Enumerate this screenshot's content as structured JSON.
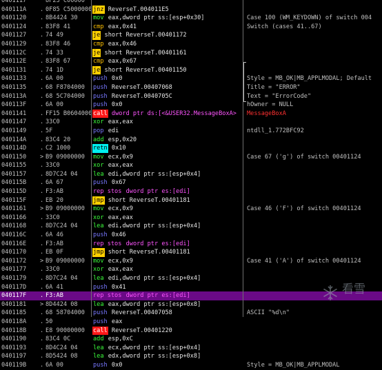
{
  "rows": [
    {
      "addr": "0401117",
      "mark": "",
      "hex": "8F23 C00000",
      "mn": "",
      "mk": "",
      "op": "",
      "oc": "",
      "cmt": "",
      "cc": ""
    },
    {
      "addr": "040111A",
      "mark": ".",
      "hex": "0F85 C5000000",
      "mn": "jnz",
      "mk": "jmp",
      "op": "ReverseT.004011E5",
      "oc": "",
      "cmt": "",
      "cc": ""
    },
    {
      "addr": "0401120",
      "mark": ".",
      "hex": "8B4424 30",
      "mn": "mov",
      "mk": "mov",
      "op": "eax,dword ptr ss:[esp+0x30]",
      "oc": "",
      "cmt": "Case 100 (WM_KEYDOWN) of switch 004",
      "cc": ""
    },
    {
      "addr": "0401124",
      "mark": ".",
      "hex": "83F8 41",
      "mn": "cmp",
      "mk": "cmp",
      "op": "eax,0x41",
      "oc": "",
      "cmt": "Switch (cases 41..67)",
      "cc": ""
    },
    {
      "addr": "0401127",
      "mark": ".",
      "hex": "74 49",
      "mn": "je",
      "mk": "jmp",
      "op": "short ReverseT.00401172",
      "oc": "",
      "cmt": "",
      "cc": ""
    },
    {
      "addr": "0401129",
      "mark": ".",
      "hex": "83F8 46",
      "mn": "cmp",
      "mk": "cmp",
      "op": "eax,0x46",
      "oc": "",
      "cmt": "",
      "cc": ""
    },
    {
      "addr": "040112C",
      "mark": ".",
      "hex": "74 33",
      "mn": "je",
      "mk": "jmp",
      "op": "short ReverseT.00401161",
      "oc": "",
      "cmt": "",
      "cc": ""
    },
    {
      "addr": "040112E",
      "mark": ".",
      "hex": "83F8 67",
      "mn": "cmp",
      "mk": "cmp",
      "op": "eax,0x67",
      "oc": "",
      "cmt": "",
      "cc": ""
    },
    {
      "addr": "0401131",
      "mark": ".",
      "hex": "74 1D",
      "mn": "je",
      "mk": "jmp",
      "op": "short ReverseT.00401150",
      "oc": "",
      "cmt": "",
      "cc": ""
    },
    {
      "addr": "0401133",
      "mark": ".",
      "hex": "6A 00",
      "mn": "push",
      "mk": "push",
      "op": "0x0",
      "oc": "",
      "cmt": "Style = MB_OK|MB_APPLMODAL; Default",
      "cc": ""
    },
    {
      "addr": "0401135",
      "mark": ".",
      "hex": "68 F8704000",
      "mn": "push",
      "mk": "push",
      "op": "ReverseT.00407068",
      "oc": "",
      "cmt": "Title = \"ERROR\"",
      "cc": ""
    },
    {
      "addr": "040113A",
      "mark": ".",
      "hex": "68 5C704000",
      "mn": "push",
      "mk": "push",
      "op": "ReverseT.0040705C",
      "oc": "",
      "cmt": "Text = \"ErrorCode\"",
      "cc": ""
    },
    {
      "addr": "040113F",
      "mark": ".",
      "hex": "6A 00",
      "mn": "push",
      "mk": "push",
      "op": "0x0",
      "oc": "",
      "cmt": "hOwner = NULL",
      "cc": ""
    },
    {
      "addr": "0401141",
      "mark": ".",
      "hex": "FF15 B0604000",
      "mn": "call",
      "mk": "call",
      "op": "dword ptr ds:[<&USER32.MessageBoxA>",
      "oc": "mag",
      "cmt": "MessageBoxA",
      "cc": "red"
    },
    {
      "addr": "0401147",
      "mark": ".",
      "hex": "33C0",
      "mn": "xor",
      "mk": "xor",
      "op": "eax,eax",
      "oc": "",
      "cmt": "",
      "cc": ""
    },
    {
      "addr": "0401149",
      "mark": ".",
      "hex": "5F",
      "mn": "pop",
      "mk": "pop",
      "op": "edi",
      "oc": "",
      "cmt": "ntdll_1.772BFC92",
      "cc": ""
    },
    {
      "addr": "040114A",
      "mark": ".",
      "hex": "83C4 20",
      "mn": "add",
      "mk": "add",
      "op": "esp,0x20",
      "oc": "",
      "cmt": "",
      "cc": ""
    },
    {
      "addr": "040114D",
      "mark": ".",
      "hex": "C2 1000",
      "mn": "retn",
      "mk": "retn",
      "op": "0x10",
      "oc": "",
      "cmt": "",
      "cc": ""
    },
    {
      "addr": "0401150",
      "mark": ">",
      "hex": "B9 09000000",
      "mn": "mov",
      "mk": "mov",
      "op": "ecx,0x9",
      "oc": "",
      "cmt": "Case 67 ('g') of switch 00401124",
      "cc": ""
    },
    {
      "addr": "0401155",
      "mark": ".",
      "hex": "33C0",
      "mn": "xor",
      "mk": "xor",
      "op": "eax,eax",
      "oc": "",
      "cmt": "",
      "cc": ""
    },
    {
      "addr": "0401157",
      "mark": ".",
      "hex": "8D7C24 04",
      "mn": "lea",
      "mk": "lea",
      "op": "edi,dword ptr ss:[esp+0x4]",
      "oc": "",
      "cmt": "",
      "cc": ""
    },
    {
      "addr": "040115B",
      "mark": ".",
      "hex": "6A 67",
      "mn": "push",
      "mk": "push",
      "op": "0x67",
      "oc": "",
      "cmt": "",
      "cc": ""
    },
    {
      "addr": "040115D",
      "mark": ".",
      "hex": "F3:AB",
      "mn": "rep stos",
      "mk": "stos",
      "op": "dword ptr es:[edi]",
      "oc": "mag",
      "cmt": "",
      "cc": ""
    },
    {
      "addr": "040115F",
      "mark": ".",
      "hex": "EB 20",
      "mn": "jmp",
      "mk": "jmp",
      "op": "short ReverseT.00401181",
      "oc": "",
      "cmt": "",
      "cc": ""
    },
    {
      "addr": "0401161",
      "mark": ">",
      "hex": "B9 09000000",
      "mn": "mov",
      "mk": "mov",
      "op": "ecx,0x9",
      "oc": "",
      "cmt": "Case 46 ('F') of switch 00401124",
      "cc": ""
    },
    {
      "addr": "0401166",
      "mark": ".",
      "hex": "33C0",
      "mn": "xor",
      "mk": "xor",
      "op": "eax,eax",
      "oc": "",
      "cmt": "",
      "cc": ""
    },
    {
      "addr": "0401168",
      "mark": ".",
      "hex": "8D7C24 04",
      "mn": "lea",
      "mk": "lea",
      "op": "edi,dword ptr ss:[esp+0x4]",
      "oc": "",
      "cmt": "",
      "cc": ""
    },
    {
      "addr": "040116C",
      "mark": ".",
      "hex": "6A 46",
      "mn": "push",
      "mk": "push",
      "op": "0x46",
      "oc": "",
      "cmt": "",
      "cc": ""
    },
    {
      "addr": "040116E",
      "mark": ".",
      "hex": "F3:AB",
      "mn": "rep stos",
      "mk": "stos",
      "op": "dword ptr es:[edi]",
      "oc": "mag",
      "cmt": "",
      "cc": ""
    },
    {
      "addr": "0401170",
      "mark": ".",
      "hex": "EB 0F",
      "mn": "jmp",
      "mk": "jmp",
      "op": "short ReverseT.00401181",
      "oc": "",
      "cmt": "",
      "cc": ""
    },
    {
      "addr": "0401172",
      "mark": ">",
      "hex": "B9 09000000",
      "mn": "mov",
      "mk": "mov",
      "op": "ecx,0x9",
      "oc": "",
      "cmt": "Case 41 ('A') of switch 00401124",
      "cc": ""
    },
    {
      "addr": "0401177",
      "mark": ".",
      "hex": "33C0",
      "mn": "xor",
      "mk": "xor",
      "op": "eax,eax",
      "oc": "",
      "cmt": "",
      "cc": ""
    },
    {
      "addr": "0401179",
      "mark": ".",
      "hex": "8D7C24 04",
      "mn": "lea",
      "mk": "lea",
      "op": "edi,dword ptr ss:[esp+0x4]",
      "oc": "",
      "cmt": "",
      "cc": ""
    },
    {
      "addr": "040117D",
      "mark": ".",
      "hex": "6A 41",
      "mn": "push",
      "mk": "push",
      "op": "0x41",
      "oc": "",
      "cmt": "",
      "cc": ""
    },
    {
      "addr": "040117F",
      "mark": ".",
      "hex": "F3:AB",
      "mn": "rep stos",
      "mk": "stos",
      "op": "dword ptr es:[edi]",
      "oc": "mag",
      "cmt": "",
      "cc": "",
      "sel": true
    },
    {
      "addr": "0401181",
      "mark": ">",
      "hex": "8D4424 08",
      "mn": "lea",
      "mk": "lea",
      "op": "eax,dword ptr ss:[esp+0x8]",
      "oc": "",
      "cmt": "",
      "cc": ""
    },
    {
      "addr": "0401185",
      "mark": ".",
      "hex": "68 58704000",
      "mn": "push",
      "mk": "push",
      "op": "ReverseT.00407058",
      "oc": "",
      "cmt": "ASCII \"%d\\n\"",
      "cc": ""
    },
    {
      "addr": "040118A",
      "mark": ".",
      "hex": "50",
      "mn": "push",
      "mk": "push",
      "op": "eax",
      "oc": "",
      "cmt": "",
      "cc": ""
    },
    {
      "addr": "040118B",
      "mark": ".",
      "hex": "E8 90000000",
      "mn": "call",
      "mk": "call",
      "op": "ReverseT.00401220",
      "oc": "",
      "cmt": "",
      "cc": ""
    },
    {
      "addr": "0401190",
      "mark": ".",
      "hex": "83C4 0C",
      "mn": "add",
      "mk": "add",
      "op": "esp,0xC",
      "oc": "",
      "cmt": "",
      "cc": ""
    },
    {
      "addr": "0401193",
      "mark": ".",
      "hex": "8D4C24 04",
      "mn": "lea",
      "mk": "lea",
      "op": "ecx,dword ptr ss:[esp+0x4]",
      "oc": "",
      "cmt": "",
      "cc": ""
    },
    {
      "addr": "0401197",
      "mark": ".",
      "hex": "8D5424 08",
      "mn": "lea",
      "mk": "lea",
      "op": "edx,dword ptr ss:[esp+0x8]",
      "oc": "",
      "cmt": "",
      "cc": ""
    },
    {
      "addr": "040119B",
      "mark": ".",
      "hex": "6A 00",
      "mn": "push",
      "mk": "push",
      "op": "0x0",
      "oc": "",
      "cmt": "Style = MB_OK|MB_APPLMODAL",
      "cc": ""
    }
  ],
  "watermark": {
    "text": "看雪"
  },
  "colors": {
    "background": "#000000",
    "selected_row": "#6a0a86",
    "jump": "#ffd000",
    "call": "#ff1818",
    "retn": "#00f0f0"
  }
}
